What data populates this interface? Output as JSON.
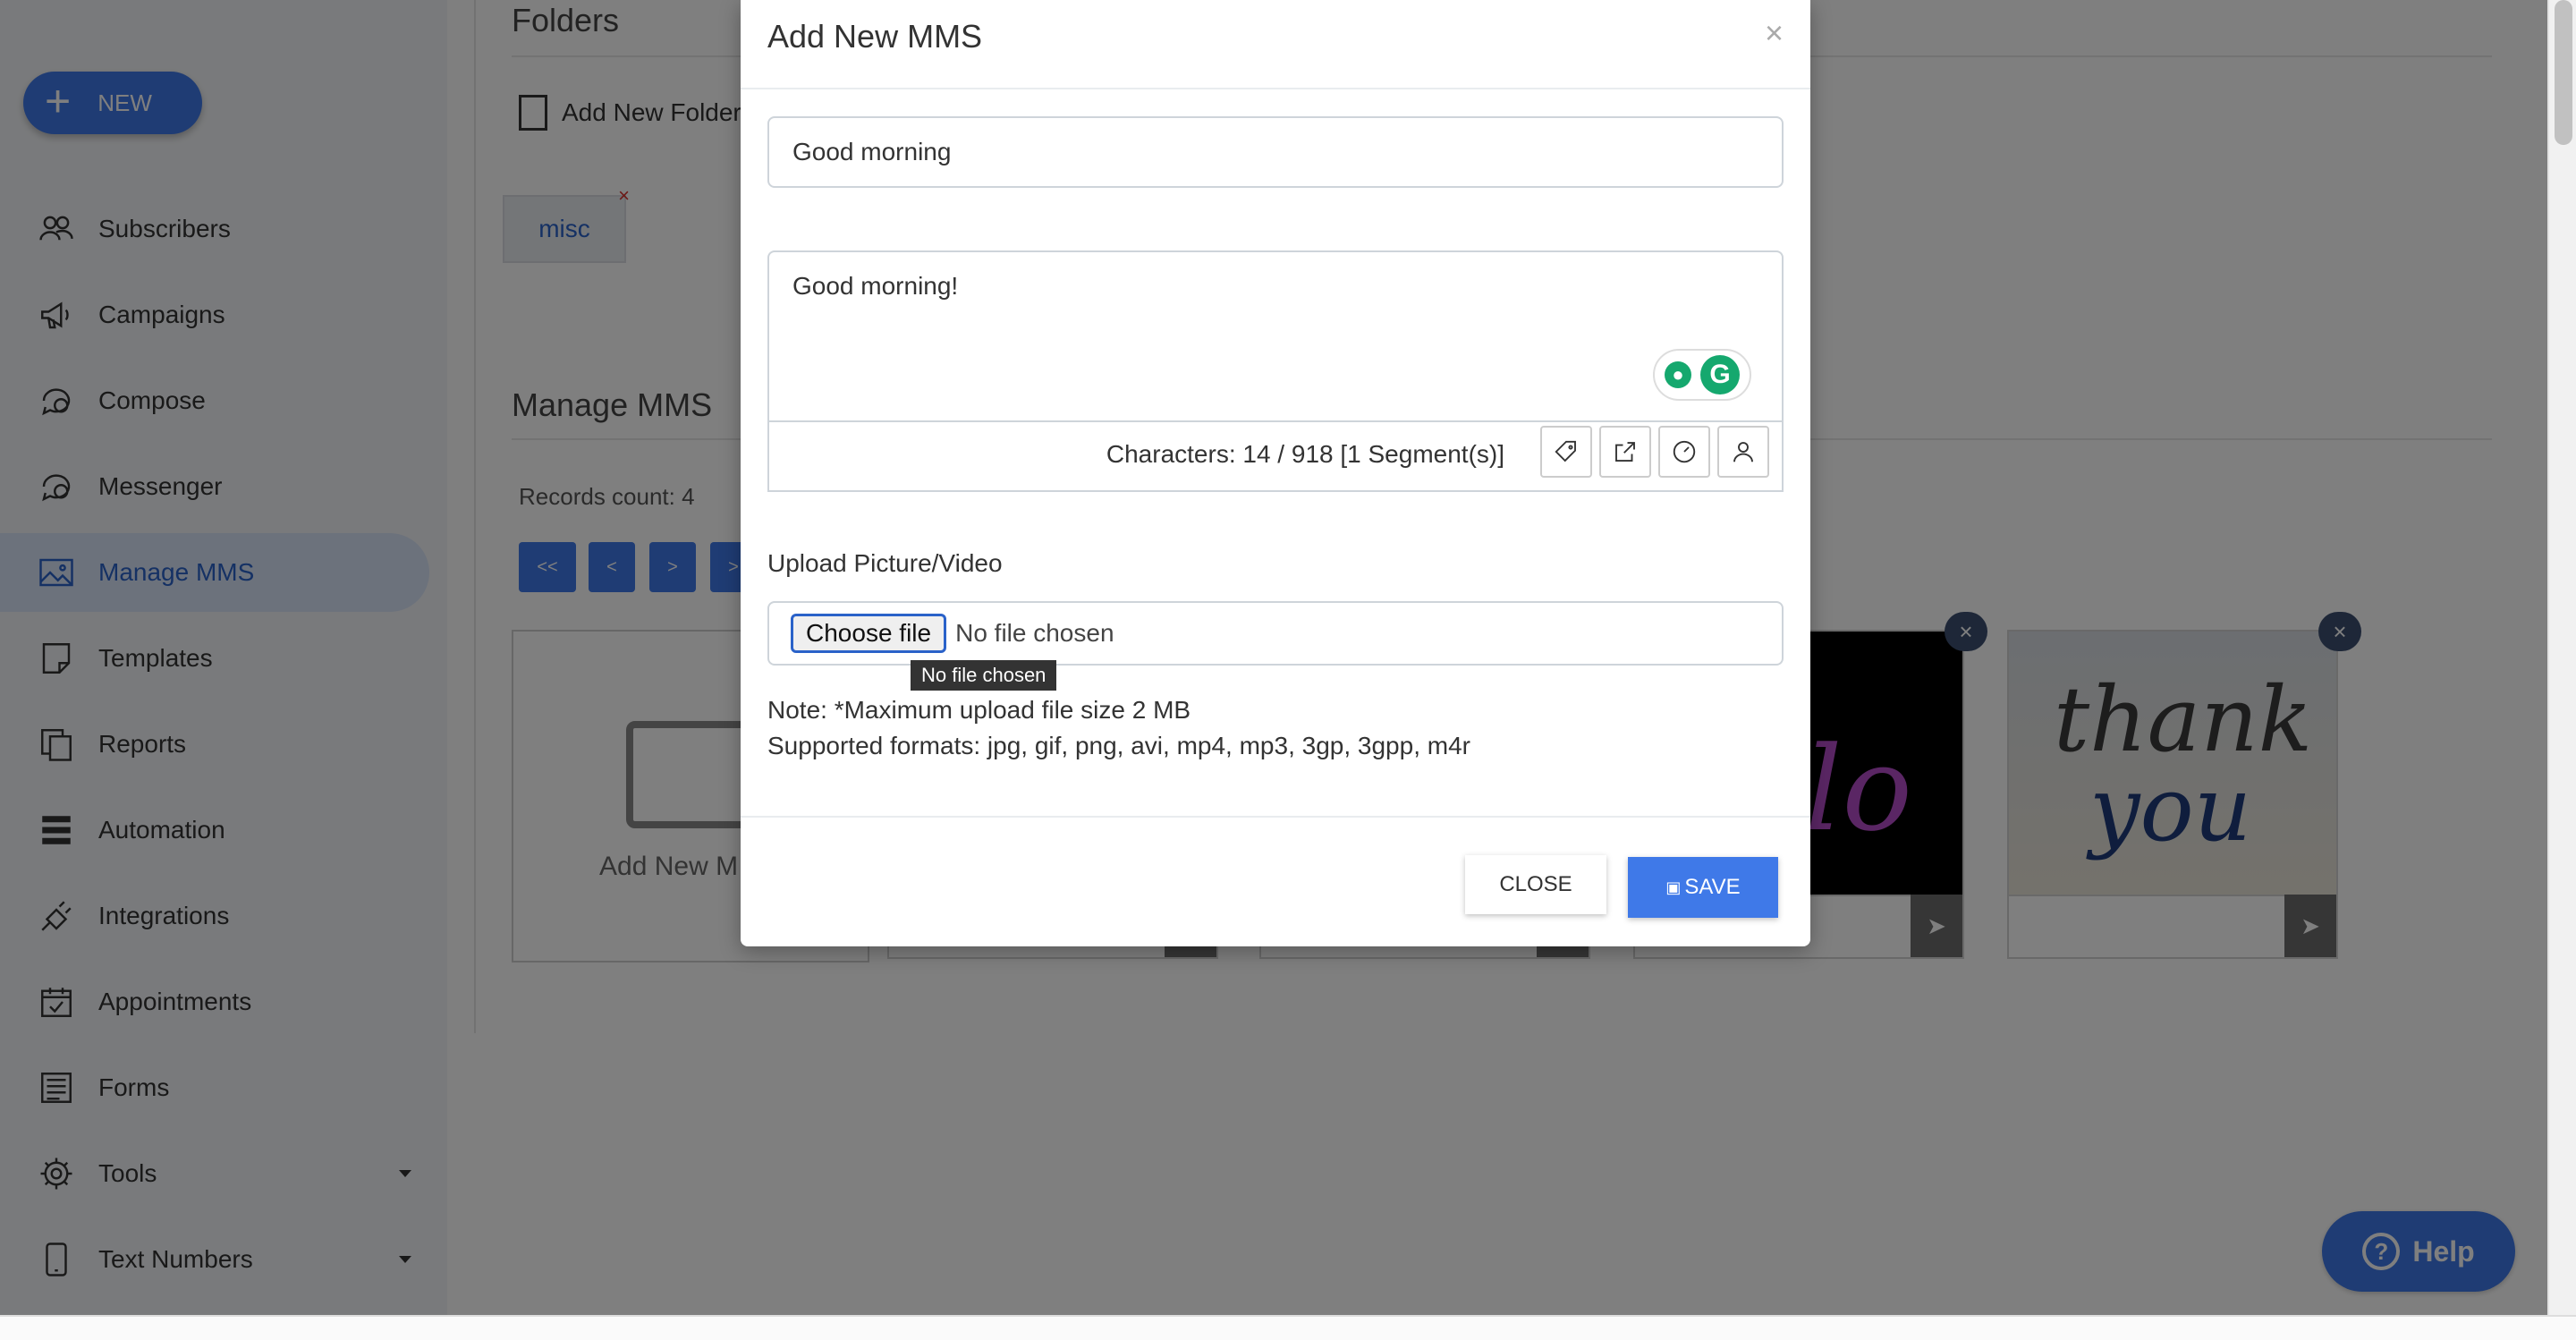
{
  "sidebar": {
    "new_label": "NEW",
    "items": [
      {
        "label": "Subscribers",
        "icon": "users-icon"
      },
      {
        "label": "Campaigns",
        "icon": "megaphone-icon"
      },
      {
        "label": "Compose",
        "icon": "compose-icon"
      },
      {
        "label": "Messenger",
        "icon": "chat-icon"
      },
      {
        "label": "Manage MMS",
        "icon": "image-icon"
      },
      {
        "label": "Templates",
        "icon": "template-icon"
      },
      {
        "label": "Reports",
        "icon": "reports-icon"
      },
      {
        "label": "Automation",
        "icon": "server-icon"
      },
      {
        "label": "Integrations",
        "icon": "plug-icon"
      },
      {
        "label": "Appointments",
        "icon": "calendar-icon"
      },
      {
        "label": "Forms",
        "icon": "form-icon"
      },
      {
        "label": "Tools",
        "icon": "gear-icon"
      },
      {
        "label": "Text Numbers",
        "icon": "phone-icon"
      }
    ]
  },
  "main": {
    "folders_title": "Folders",
    "add_folder_label": "Add New Folder",
    "folder_chip": "misc",
    "manage_title": "Manage MMS",
    "records_count": "Records count: 4",
    "pagination": [
      "<<",
      "<",
      ">",
      ">"
    ],
    "add_new_card_label": "Add New M",
    "card3_text": "lo",
    "card4_text_line1": "thank",
    "card4_text_line2": "you"
  },
  "modal": {
    "title": "Add New MMS",
    "close_x": "×",
    "title_value": "Good morning",
    "message_value": "Good morning!",
    "counter": "Characters: 14 / 918 [1 Segment(s)]",
    "upload_label": "Upload Picture/Video",
    "choose_file": "Choose file",
    "no_file": "No file chosen",
    "tooltip": "No file chosen",
    "note_line1": "Note: *Maximum upload file size 2 MB",
    "note_line2": "Supported formats: jpg, gif, png, avi, mp4, mp3, 3gp, 3gpp, m4r",
    "close_label": "CLOSE",
    "save_label": "SAVE"
  },
  "help_label": "Help",
  "colors": {
    "primary": "#3f79e8",
    "active_bg": "#d9e4f9",
    "grammarly": "#15a86e"
  }
}
